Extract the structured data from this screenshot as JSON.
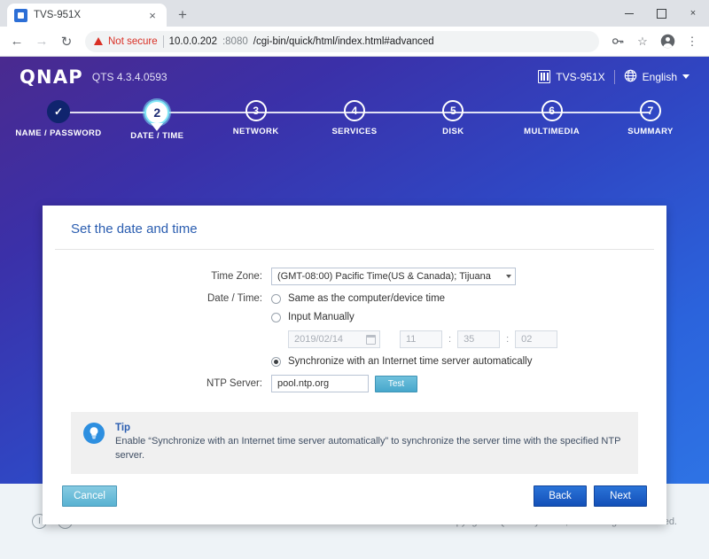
{
  "browser": {
    "tab": {
      "title": "TVS-951X",
      "favicon": "qnap-favicon",
      "close_label": "×"
    },
    "newtab_label": "+",
    "window": {
      "minimize": "–",
      "maximize": "□",
      "close": "×"
    },
    "nav": {
      "back": "←",
      "forward": "→",
      "reload": "↻"
    },
    "omnibox": {
      "security_text": "Not secure",
      "url_host": "10.0.0.202",
      "url_port": ":8080",
      "url_path": "/cgi-bin/quick/html/index.html#advanced"
    },
    "icons": {
      "key": "key-icon",
      "star": "☆",
      "profile": "profile-icon",
      "menu": "⋮"
    }
  },
  "app": {
    "header": {
      "logo": "QNAP",
      "version": "QTS 4.3.4.0593",
      "device_name": "TVS-951X",
      "language": "English"
    },
    "steps": [
      {
        "num": "✓",
        "label": "NAME / PASSWORD",
        "state": "done"
      },
      {
        "num": "2",
        "label": "DATE / TIME",
        "state": "active"
      },
      {
        "num": "3",
        "label": "NETWORK",
        "state": "todo"
      },
      {
        "num": "4",
        "label": "SERVICES",
        "state": "todo"
      },
      {
        "num": "5",
        "label": "DISK",
        "state": "todo"
      },
      {
        "num": "6",
        "label": "MULTIMEDIA",
        "state": "todo"
      },
      {
        "num": "7",
        "label": "SUMMARY",
        "state": "todo"
      }
    ],
    "card": {
      "title": "Set the date and time",
      "timezone": {
        "label": "Time Zone:",
        "value": "(GMT-08:00) Pacific Time(US & Canada); Tijuana"
      },
      "datetime": {
        "label": "Date / Time:",
        "option_same": "Same as the computer/device time",
        "option_manual": "Input Manually",
        "option_sync": "Synchronize with an Internet time server automatically",
        "date_value": "2019/02/14",
        "hour": "11",
        "minute": "35",
        "second": "02",
        "colon": ":"
      },
      "ntp": {
        "label": "NTP Server:",
        "value": "pool.ntp.org",
        "placeholder": "pool.ntp.org",
        "test_label": "Test"
      },
      "tip": {
        "title": "Tip",
        "body": "Enable “Synchronize with an Internet time server automatically” to synchronize the server time with the specified NTP server."
      },
      "buttons": {
        "cancel": "Cancel",
        "back": "Back",
        "next": "Next"
      }
    },
    "footer": {
      "power_icon": "power-icon",
      "restart_icon": "restart-icon",
      "copyright": "Copyright © QNAP Systems, Inc. All Rights Reserved."
    }
  },
  "colors": {
    "accent_blue": "#2a5db0",
    "primary_button": "#1350b8",
    "cancel_button": "#59b2d2",
    "test_button": "#47a7cc",
    "warning_red": "#d93025",
    "tip_bg": "#f0f0f0"
  }
}
